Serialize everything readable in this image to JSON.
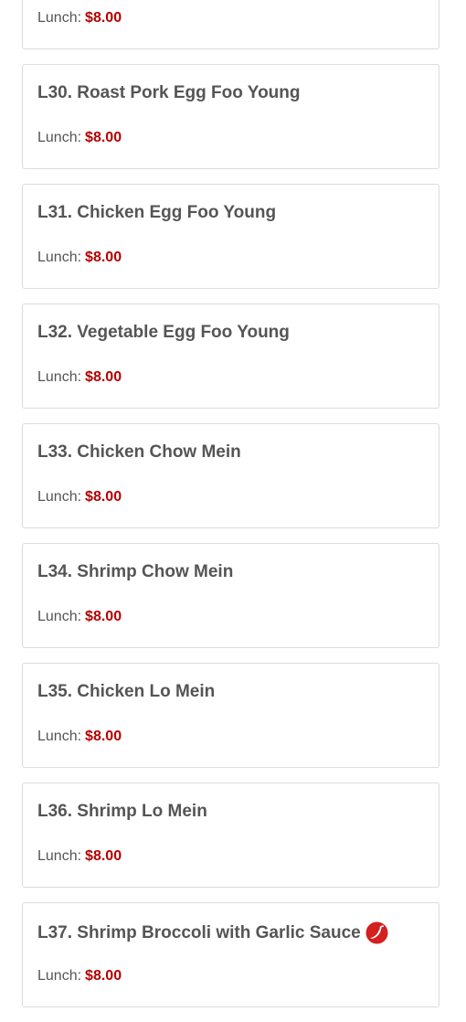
{
  "menu": {
    "price_label": "Lunch:",
    "items": [
      {
        "name": "",
        "price": "$8.00",
        "spicy": false
      },
      {
        "name": "L30. Roast Pork Egg Foo Young",
        "price": "$8.00",
        "spicy": false
      },
      {
        "name": "L31. Chicken Egg Foo Young",
        "price": "$8.00",
        "spicy": false
      },
      {
        "name": "L32. Vegetable Egg Foo Young",
        "price": "$8.00",
        "spicy": false
      },
      {
        "name": "L33. Chicken Chow Mein",
        "price": "$8.00",
        "spicy": false
      },
      {
        "name": "L34. Shrimp Chow Mein",
        "price": "$8.00",
        "spicy": false
      },
      {
        "name": "L35. Chicken Lo Mein",
        "price": "$8.00",
        "spicy": false
      },
      {
        "name": "L36. Shrimp Lo Mein",
        "price": "$8.00",
        "spicy": false
      },
      {
        "name": "L37. Shrimp Broccoli with Garlic Sauce",
        "price": "$8.00",
        "spicy": true
      }
    ]
  },
  "colors": {
    "price": "#b30000",
    "spicy_icon": "#d32020"
  },
  "icons": {
    "spicy": "hot-pepper-icon"
  }
}
